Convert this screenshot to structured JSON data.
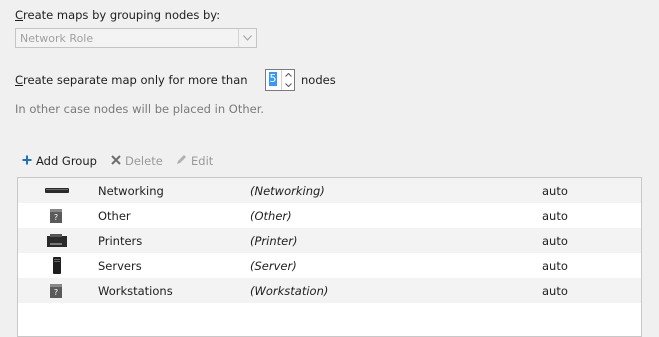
{
  "grouping": {
    "label_prefix": "",
    "label_accel": "C",
    "label_rest": "reate maps by grouping nodes by:",
    "select_value": "Network Role"
  },
  "threshold": {
    "label_accel": "C",
    "label_rest": "reate separate map only for more than",
    "value": "5",
    "suffix": "nodes",
    "hint": "In other case nodes will be placed in Other."
  },
  "toolbar": {
    "add_label": "Add Group",
    "delete_label": "Delete",
    "edit_label": "Edit"
  },
  "groups": {
    "rows": [
      {
        "name": "Networking",
        "filter": "(Networking)",
        "mode": "auto",
        "icon": "network-switch-icon"
      },
      {
        "name": "Other",
        "filter": "(Other)",
        "mode": "auto",
        "icon": "unknown-device-icon"
      },
      {
        "name": "Printers",
        "filter": "(Printer)",
        "mode": "auto",
        "icon": "printer-icon"
      },
      {
        "name": "Servers",
        "filter": "(Server)",
        "mode": "auto",
        "icon": "server-icon"
      },
      {
        "name": "Workstations",
        "filter": "(Workstation)",
        "mode": "auto",
        "icon": "workstation-icon"
      }
    ]
  }
}
